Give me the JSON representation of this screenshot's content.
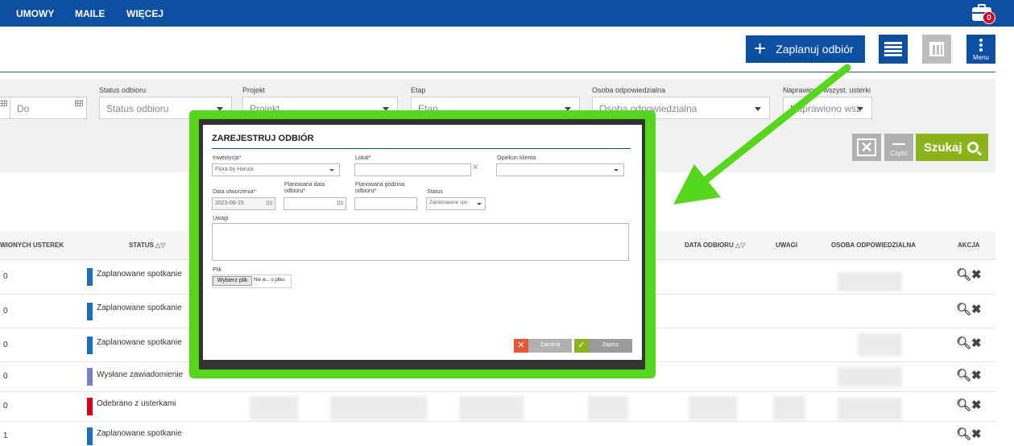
{
  "nav": {
    "items": [
      "UMOWY",
      "MAILE",
      "WIĘCEJ"
    ],
    "badge_count": "0"
  },
  "toolbar": {
    "plan_label": "Zaplanuj odbiór",
    "menu_label": "Menu"
  },
  "filters": {
    "date_to_placeholder": "Do",
    "status_label": "Status odbioru",
    "status_value": "Status odbioru",
    "project_label": "Projekt",
    "project_value": "Projekt",
    "stage_label": "Etap",
    "stage_value": "Etap",
    "owner_label": "Osoba odpowiedzialna",
    "owner_value": "Osoba odpowiedzialna",
    "fixed_label": "Naprawiono wszyst. usterki",
    "fixed_value": "Naprawiono wsz",
    "clear_label": "Czyść",
    "search_label": "Szukaj"
  },
  "table": {
    "headers": {
      "defects": "WIONYCH USTEREK",
      "status": "STATUS",
      "date": "DATA ODBIORU",
      "notes": "UWAGI",
      "owner": "OSOBA ODPOWIEDZIALNA",
      "action": "AKCJA"
    },
    "rows": [
      {
        "count": "0",
        "status": "Zaplanowane spotkanie",
        "color": "#1a6fbf"
      },
      {
        "count": "0",
        "status": "Zaplanowane spotkanie",
        "color": "#1a6fbf"
      },
      {
        "count": "0",
        "status": "Zaplanowane spotkanie",
        "color": "#1a6fbf"
      },
      {
        "count": "0",
        "status": "Wysłane zawiadomienie",
        "color": "#7680c0"
      },
      {
        "count": "0",
        "status": "Odebrano z usterkami",
        "color": "#d0021b"
      },
      {
        "count": "1",
        "status": "Zaplanowane spotkanie",
        "color": "#1a6fbf"
      }
    ]
  },
  "modal": {
    "title": "ZAREJESTRUJ ODBIÓR",
    "investment_label": "Inwestycja",
    "investment_value": "Flora by Hanza",
    "unit_label": "Lokal",
    "supervisor_label": "Opiekun klienta",
    "created_label": "Data utworzenia",
    "created_value": "2023-06-15",
    "planned_date_label_1": "Planowana data",
    "planned_date_label_2": "odbioru",
    "planned_time_label_1": "Planowana godzina",
    "planned_time_label_2": "odbioru",
    "status_label": "Status",
    "status_value": "Zaplanowane spo",
    "notes_label": "Uwagi",
    "file_label": "Plik",
    "file_button": "Wybierz plik",
    "file_text": "Nie w... o pliku",
    "close_label": "Zamknij",
    "save_label": "Zapisz"
  },
  "colors": {
    "nav": "#0b4fa3",
    "highlight": "#55d51c",
    "accent_green": "#8ab31c"
  }
}
